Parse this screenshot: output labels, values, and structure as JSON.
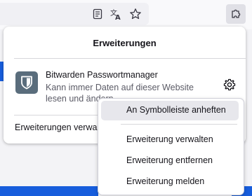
{
  "toolbar": {
    "reader_view_icon": "reader-view-icon",
    "translate_icon": "translate-icon",
    "bookmark_icon": "star-icon",
    "extensions_icon": "puzzle-icon"
  },
  "panel": {
    "title": "Erweiterungen",
    "extension": {
      "name": "Bitwarden Passwortmanager",
      "description": "Kann immer Daten auf dieser Website lesen und ändern",
      "logo_icon": "bitwarden-shield-icon",
      "settings_icon": "gear-icon"
    },
    "manage_label": "Erweiterungen verwalten"
  },
  "context_menu": {
    "items": [
      {
        "label": "An Symbolleiste anheften",
        "highlighted": true
      },
      {
        "label": "Erweiterung verwalten"
      },
      {
        "label": "Erweiterung entfernen"
      },
      {
        "label": "Erweiterung melden"
      }
    ]
  },
  "colors": {
    "accent": "#175ddc",
    "bitwarden_logo": "#5a6d7c"
  }
}
